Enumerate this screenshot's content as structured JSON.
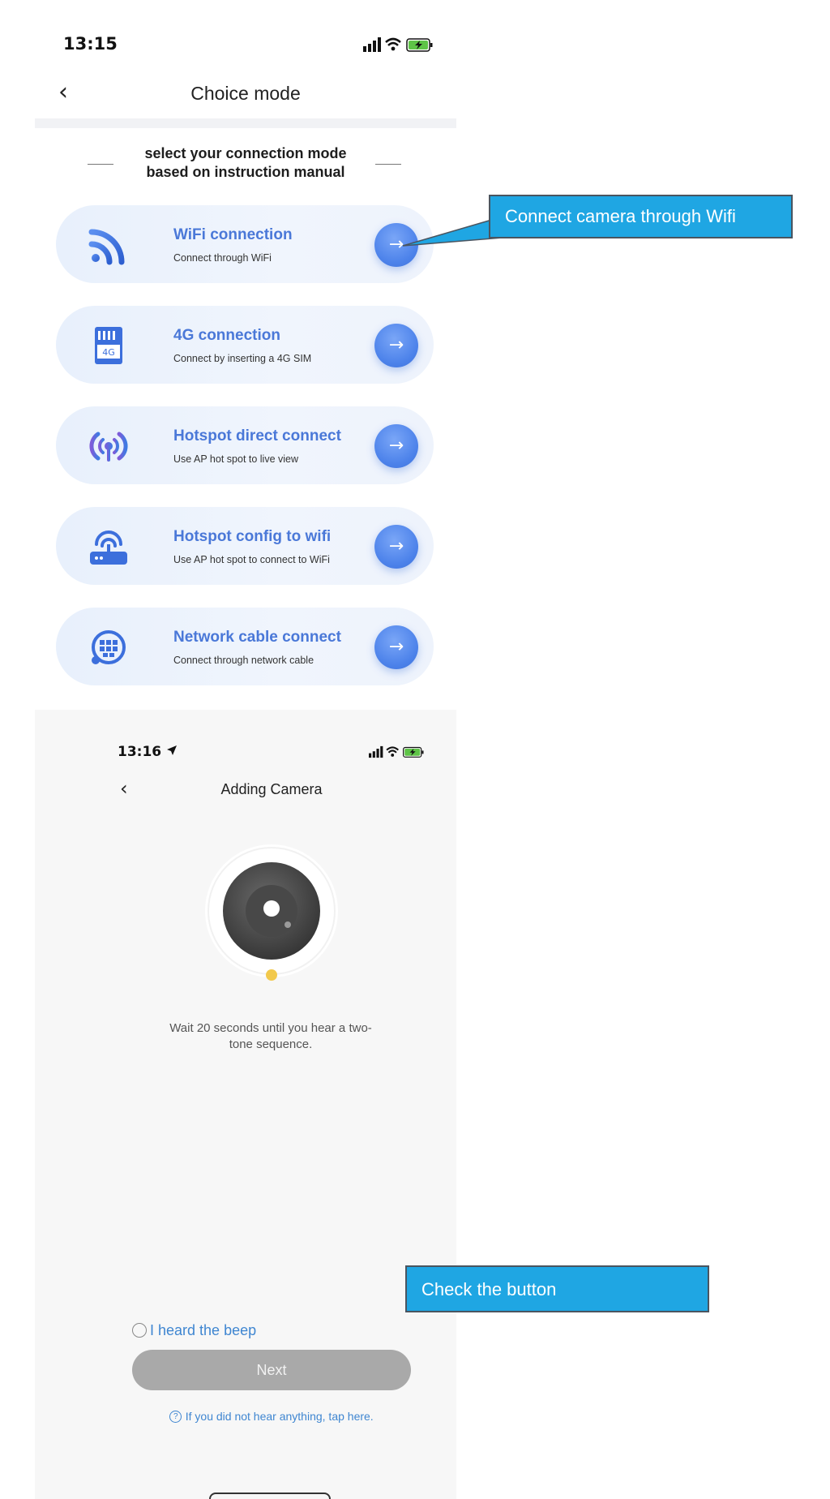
{
  "screen1": {
    "status": {
      "time": "13:15"
    },
    "header": {
      "title": "Choice mode"
    },
    "instruction": {
      "line1": "select your connection mode",
      "line2": "based on instruction manual"
    },
    "options": [
      {
        "title": "WiFi connection",
        "subtitle": "Connect through WiFi",
        "icon": "wifi-icon",
        "arrow": "→"
      },
      {
        "title": "4G connection",
        "subtitle": "Connect by inserting a 4G SIM",
        "icon": "sim-card-icon",
        "icon_text": "4G",
        "arrow": "→"
      },
      {
        "title": "Hotspot direct connect",
        "subtitle": "Use AP hot spot to live view",
        "icon": "hotspot-icon",
        "arrow": "→"
      },
      {
        "title": "Hotspot config to wifi",
        "subtitle": "Use AP hot spot to connect to WiFi",
        "icon": "router-icon",
        "arrow": "→"
      },
      {
        "title": "Network cable connect",
        "subtitle": "Connect through network cable",
        "icon": "network-globe-icon",
        "arrow": "→"
      }
    ]
  },
  "screen2": {
    "status": {
      "time": "13:16"
    },
    "header": {
      "title": "Adding Camera"
    },
    "message": {
      "line1": "Wait 20 seconds until you hear a two-",
      "line2": "tone sequence."
    },
    "beep_label": "I heard the beep",
    "next_label": "Next",
    "help_text": "If you did not hear anything, tap here."
  },
  "annotations": {
    "wifi_callout": "Connect camera through Wifi",
    "button_callout": "Check the button"
  },
  "colors": {
    "accent": "#4a78d8",
    "button_blue": "#4c82ea",
    "callout": "#1fa6e3",
    "link": "#3f86d1",
    "next_disabled": "#a9a9a9",
    "indicator": "#f2c94c"
  }
}
